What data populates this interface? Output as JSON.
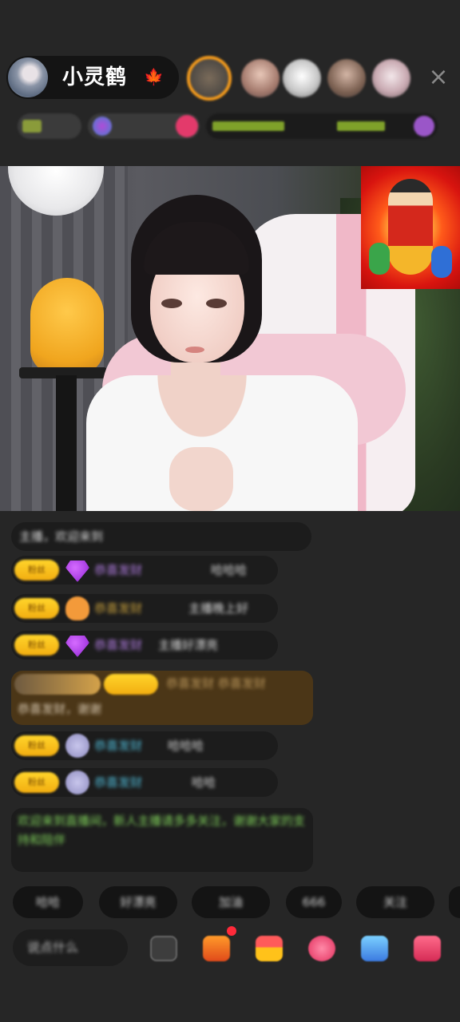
{
  "header": {
    "host_name": "小灵鹤",
    "host_name_emoji": "🍁",
    "close_icon_glyph": "×",
    "viewer_avatars": [
      "viewer-avatar-1",
      "viewer-avatar-2",
      "viewer-avatar-3",
      "viewer-avatar-4",
      "viewer-avatar-5"
    ]
  },
  "video": {
    "inset_sticker": "god-of-wealth-sticker"
  },
  "chat": {
    "system_line": "主播，欢迎来到",
    "messages": [
      {
        "badge": "粉丝",
        "name": "恭喜发财",
        "text": "哈哈哈"
      },
      {
        "badge": "粉丝",
        "name": "恭喜发财",
        "text": "主播晚上好"
      },
      {
        "badge": "粉丝",
        "name": "恭喜发财",
        "text": "主播好漂亮"
      },
      {
        "badge": "粉丝",
        "name": "恭喜发财",
        "text": "哈哈哈"
      },
      {
        "badge": "粉丝",
        "name": "恭喜发财",
        "text": "哈哈"
      }
    ],
    "highlight_message": "恭喜发财 恭喜发财",
    "notice_message": "欢迎来到直播间，新人主播请多多关注，谢谢大家的支持和陪伴"
  },
  "quick_replies": [
    "哈哈",
    "好漂亮",
    "加油",
    "666",
    "关注"
  ],
  "bottom_bar": {
    "say_placeholder": "说点什么",
    "icons": [
      "more-icon",
      "gift-box-icon",
      "red-packet-icon",
      "heart-icon",
      "game-icon",
      "gift-icon"
    ]
  },
  "colors": {
    "background": "#262626",
    "badge_gold": "#ffd42a",
    "notice_green": "#7fcf5a",
    "highlight_brown": "#4b3617"
  }
}
